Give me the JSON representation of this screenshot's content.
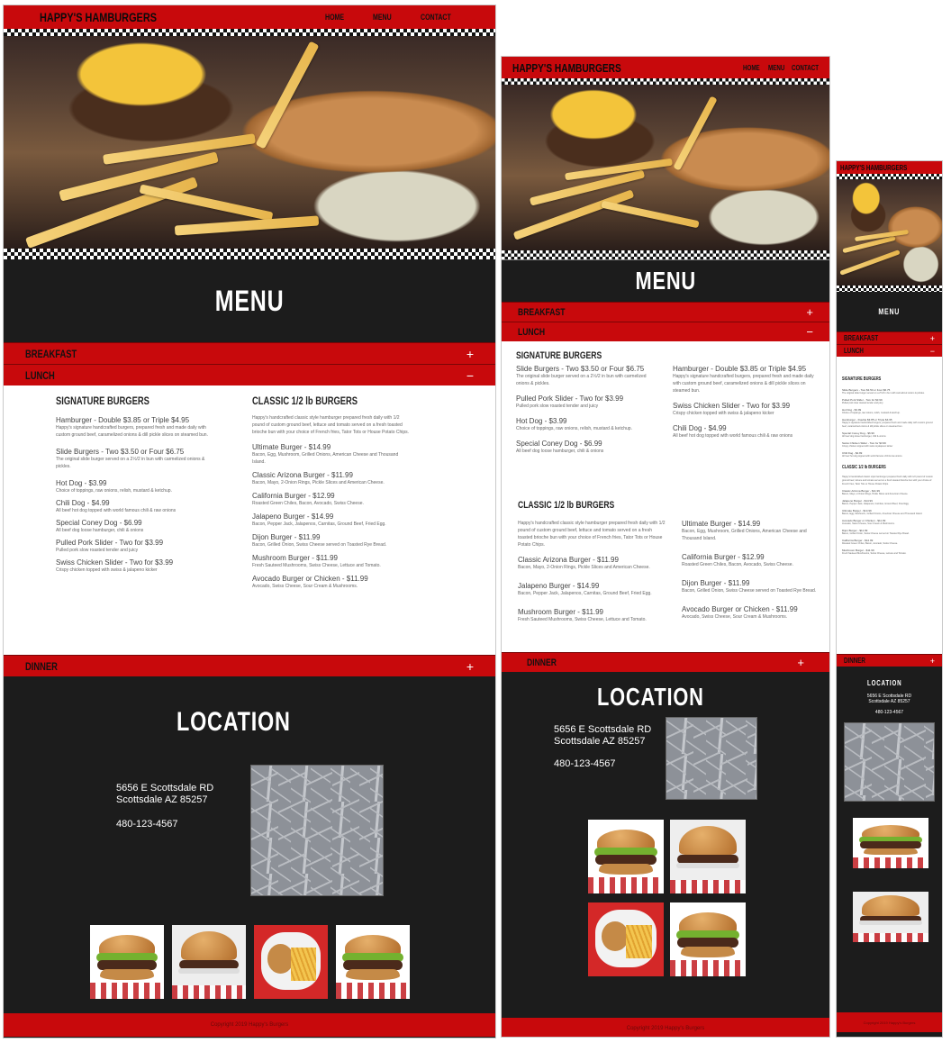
{
  "site": {
    "brand": "HAPPY'S HAMBURGERS",
    "nav": [
      "HOME",
      "MENU",
      "CONTACT"
    ]
  },
  "menu_title": "MENU",
  "accordion": {
    "breakfast": "BREAKFAST",
    "lunch": "LUNCH",
    "dinner": "DINNER",
    "plus": "+",
    "minus": "−"
  },
  "signature": {
    "title": "SIGNATURE BURGERS",
    "items": [
      {
        "name": "Hamburger - Double $3.85 or Triple $4.95",
        "desc": "Happy's signature handcrafted burgers, prepared fresh and made daily with custom ground beef, caramelized onions & dill pickle slices on steamed bun."
      },
      {
        "name": "Slide Burgers - Two $3.50 or Four $6.75",
        "desc": "The original slide burger served on a 2½/2 in bun with carmelized onions & pickles."
      },
      {
        "name": "Hot Dog - $3.99",
        "desc": "Choice of toppings, raw onions, relish, mustard & ketchup."
      },
      {
        "name": "Chili Dog - $4.99",
        "desc": "All beef hot dog topped with world famous chili & raw onions"
      },
      {
        "name": "Special Coney Dog - $6.99",
        "desc": "All beef dog loose hamburger, chili & onions"
      },
      {
        "name": "Pulled Pork Slider - Two for $3.99",
        "desc": "Pulled pork slow roasted tender and juicy"
      },
      {
        "name": "Swiss Chicken Slider - Two for $3.99",
        "desc": "Crispy chicken topped with swiss & jalapeno kicker"
      }
    ]
  },
  "classic": {
    "title": "CLASSIC 1/2 lb BURGERS",
    "intro": "Happy's handcrafted classic style hamburger prepared fresh daily with 1/2 pound of custom ground beef, lettuce and tomato served on a fresh toasted brioche bun with your choice of French fries, Tator Tots or House Potato Chips.",
    "items": [
      {
        "name": "Ultimate Burger - $14.99",
        "desc": "Bacon, Egg, Mushroom, Grilled Onions, American Cheese and Thousand Island."
      },
      {
        "name": "Classic Arizona Burger - $11.99",
        "desc": "Bacon, Mayo, 2-Onion Rings, Pickle Slices and American Cheese."
      },
      {
        "name": "California Burger - $12.99",
        "desc": "Roasted Green Chiles, Bacon, Avocado, Swiss Cheese."
      },
      {
        "name": "Jalapeno Burger - $14.99",
        "desc": "Bacon, Pepper Jack, Jalapenos, Carnitas, Ground Beef, Fried Egg."
      },
      {
        "name": "Dijon Burger - $11.99",
        "desc": "Bacon, Grilled Onion, Swiss Cheese served on Toasted Rye Bread."
      },
      {
        "name": "Mushroom Burger - $11.99",
        "desc": "Fresh Sauteed Mushrooms, Swiss Cheese, Lettuce and Tomato."
      },
      {
        "name": "Avocado Burger or Chicken - $11.99",
        "desc": "Avocado, Swiss Cheese, Sour Cream & Mushrooms."
      }
    ]
  },
  "location": {
    "title": "LOCATION",
    "address1": "5656 E Scottsdale RD",
    "address2": "Scottsdale AZ 85257",
    "phone": "480-123-4567"
  },
  "footer": "Copyright 2019 Happy's Burgers"
}
